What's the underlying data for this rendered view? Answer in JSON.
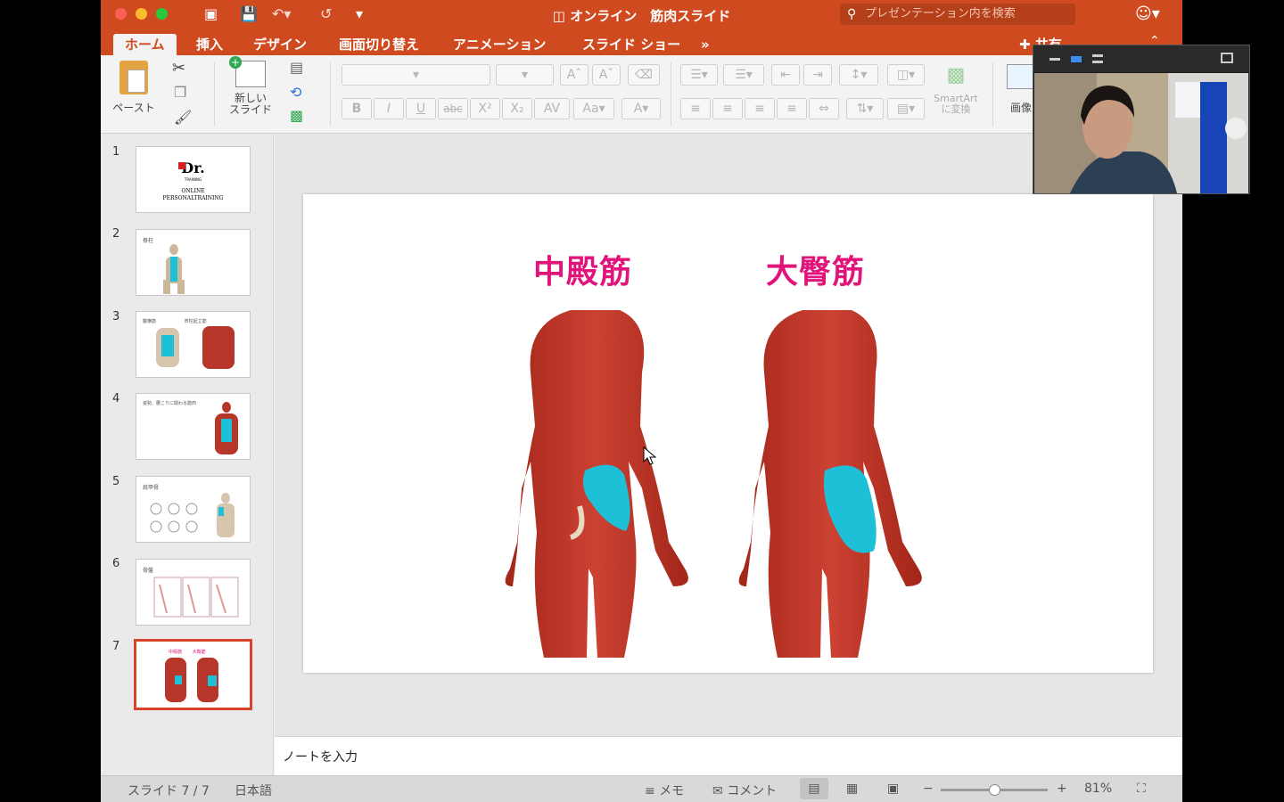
{
  "window": {
    "title": "オンライン　筋肉スライド"
  },
  "search": {
    "placeholder": "プレゼンテーション内を検索"
  },
  "tabs": [
    {
      "label": "ホーム"
    },
    {
      "label": "挿入"
    },
    {
      "label": "デザイン"
    },
    {
      "label": "画面切り替え"
    },
    {
      "label": "アニメーション"
    },
    {
      "label": "スライド ショー"
    },
    {
      "label": "»"
    }
  ],
  "share_label": "共有",
  "ribbon": {
    "paste": "ペースト",
    "new_slide": "新しい\nスライド",
    "smartart": "SmartArt\nに変換",
    "picture": "画像",
    "bold": "B",
    "italic": "I",
    "underline": "U",
    "strike": "abc",
    "superscript": "X²",
    "subscript": "X₂"
  },
  "slides": [
    {
      "number": "1",
      "caption_line1": "Dr.",
      "caption_line2": "TRAINING",
      "caption_line3": "ONLINE",
      "caption_line4": "PERSONALTRAINING"
    },
    {
      "number": "2",
      "caption": "脊柱"
    },
    {
      "number": "3",
      "caption": "腹横筋　　　　　　 脊柱起立筋"
    },
    {
      "number": "4",
      "caption": "姿勢、腰こりに関わる筋肉"
    },
    {
      "number": "5",
      "caption": "肩甲骨"
    },
    {
      "number": "6",
      "caption": "骨盤"
    },
    {
      "number": "7",
      "caption": "中殿筋　　 大臀筋"
    }
  ],
  "current_slide": {
    "left_title": "中殿筋",
    "right_title": "大臀筋"
  },
  "notes": {
    "placeholder": "ノートを入力"
  },
  "status": {
    "slide_counter": "スライド 7 / 7",
    "language": "日本語",
    "memo": "メモ",
    "comment": "コメント",
    "zoom": "81%",
    "zoom_fraction": 0.5
  },
  "colors": {
    "accent": "#d04a1f",
    "title_pink": "#e0147a",
    "muscle_highlight": "#1ec0d8"
  }
}
